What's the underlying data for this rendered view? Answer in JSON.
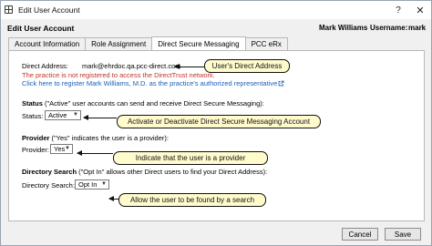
{
  "window": {
    "title": "Edit User Account",
    "help_glyph": "?",
    "close_glyph": "✕"
  },
  "header": {
    "title": "Edit User Account",
    "user_full_name": "Mark Williams",
    "username_label": "Username:",
    "username": "mark"
  },
  "tabs": [
    {
      "label": "Account Information",
      "active": false
    },
    {
      "label": "Role Assignment",
      "active": false
    },
    {
      "label": "Direct Secure Messaging",
      "active": true
    },
    {
      "label": "PCC eRx",
      "active": false
    }
  ],
  "direct": {
    "address_label": "Direct Address:",
    "address_value": "mark@ehrdoc.qa.pcc-direct.com",
    "not_registered_notice": "The practice is not registered to access the DirectTrust network.",
    "register_link": "Click here to register Mark Williams, M.D. as the practice's authorized representative"
  },
  "status": {
    "heading_bold": "Status",
    "heading_rest": " (\"Active\" user accounts can send and receive Direct Secure Messaging):",
    "label": "Status:",
    "value": "Active"
  },
  "provider": {
    "heading_bold": "Provider",
    "heading_rest": " (\"Yes\" indicates the user is a provider):",
    "label": "Provider:",
    "value": "Yes"
  },
  "directory": {
    "heading_bold": "Directory Search",
    "heading_rest": " (\"Opt In\" allows other Direct users to find your Direct Address):",
    "label": "Directory Search:",
    "value": "Opt In"
  },
  "callouts": {
    "direct_address": "User's Direct Address",
    "status": "Activate or Deactivate Direct Secure Messaging Account",
    "provider": "Indicate that the user is a provider",
    "directory": "Allow the user to be found by a search"
  },
  "footer": {
    "cancel_label": "Cancel",
    "save_label": "Save"
  },
  "icons": {
    "app": "app-window-icon",
    "external_link": "external-link-icon",
    "dropdown": "chevron-down-icon"
  }
}
